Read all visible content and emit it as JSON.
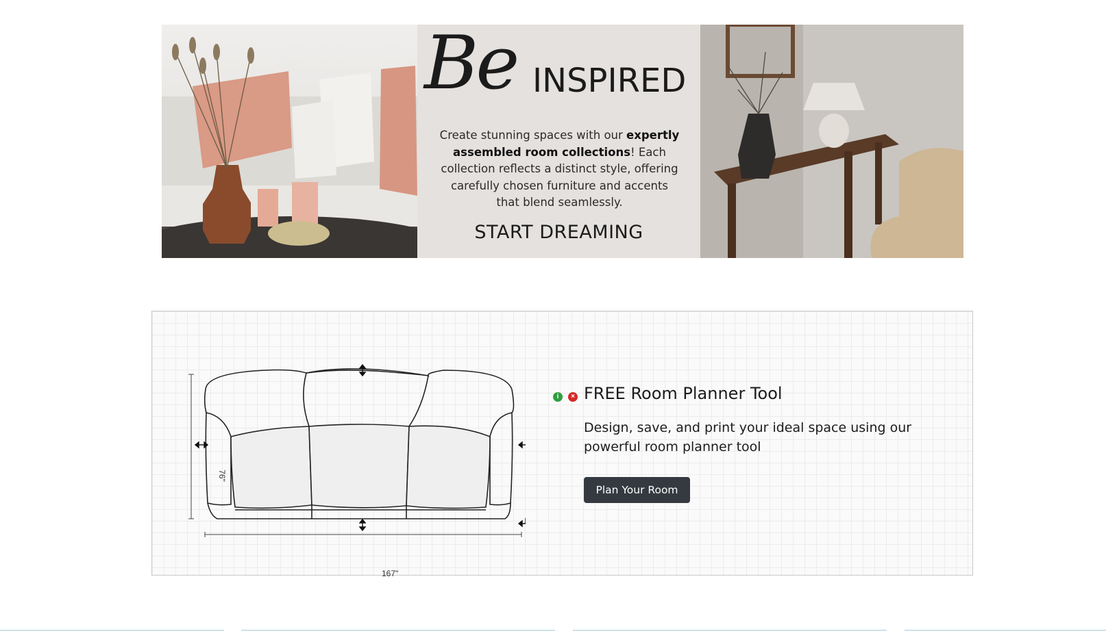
{
  "banner": {
    "script_word": "Be",
    "title_word": "INSPIRED",
    "text_prefix": "Create stunning spaces with our ",
    "text_bold": "expertly assembled room collections",
    "text_suffix": "! Each collection reflects a distinct style, offering carefully chosen furniture and accents that blend seamlessly.",
    "cta": "START DREAMING"
  },
  "planner": {
    "title": "FREE Room Planner Tool",
    "description": "Design, save, and print your ideal space using our powerful room planner tool",
    "button_label": "Plan Your Room",
    "width_dimension": "167\"",
    "depth_dimension": "76\"",
    "info_icon_glyph": "i",
    "delete_icon_glyph": "×"
  },
  "colors": {
    "button_bg": "#343a40",
    "info_green": "#2e9e3f",
    "delete_red": "#d32a2a"
  }
}
